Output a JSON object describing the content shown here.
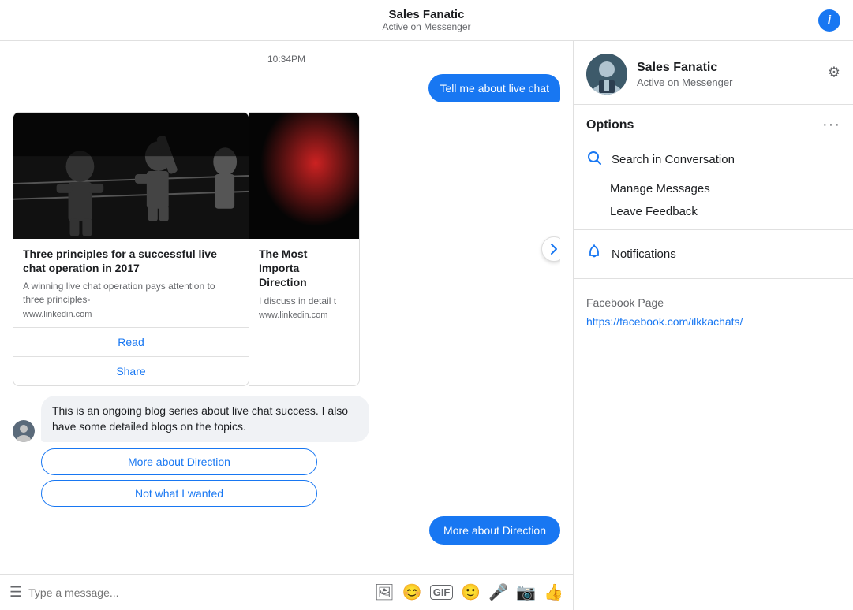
{
  "header": {
    "title": "Sales Fanatic",
    "subtitle": "Active on Messenger",
    "info_icon": "i"
  },
  "timestamp": "10:34PM",
  "messages": [
    {
      "type": "outgoing",
      "text": "Tell me about live chat"
    }
  ],
  "cards": [
    {
      "title": "Three principles for a successful live chat operation in 2017",
      "description": "A winning live chat operation pays attention to three principles-",
      "source": "www.linkedin.com",
      "btn1": "Read",
      "btn2": "Share"
    },
    {
      "title": "The Most Importa Direction",
      "description": "I discuss in detail t",
      "source": "www.linkedin.com"
    }
  ],
  "bot_message": "This is an ongoing blog series about live chat success. I also have some detailed blogs on the topics.",
  "quick_replies": [
    "More about Direction",
    "Not what I wanted"
  ],
  "outgoing_pill": "More about Direction",
  "input": {
    "placeholder": "Type a message..."
  },
  "sidebar": {
    "name": "Sales Fanatic",
    "status": "Active on Messenger",
    "options_label": "Options",
    "items": [
      {
        "label": "Search in Conversation",
        "icon": "search"
      },
      {
        "label": "Manage Messages"
      },
      {
        "label": "Leave Feedback"
      },
      {
        "label": "Notifications",
        "icon": "bell"
      }
    ],
    "facebook_page_label": "Facebook Page",
    "facebook_link": "https://facebook.com/ilkkachats/"
  }
}
